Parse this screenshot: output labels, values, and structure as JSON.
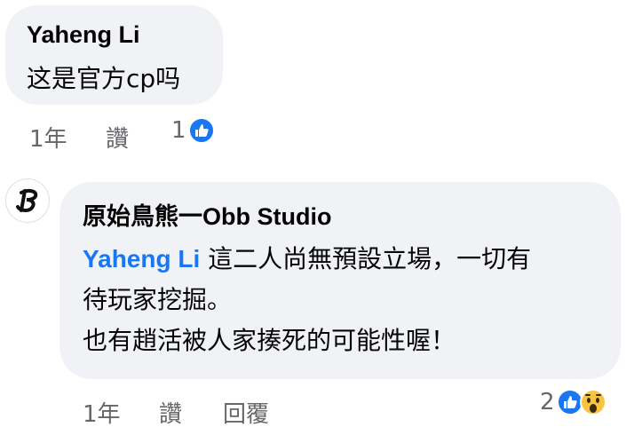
{
  "comments": [
    {
      "author": "Yaheng Li",
      "text": "这是官方cp吗",
      "time": "1年",
      "like_label": "讚",
      "reaction_count": "1",
      "reactions": [
        "like-icon"
      ]
    },
    {
      "author": "原始鳥熊一Obb Studio",
      "mention": "Yaheng Li",
      "line1": " 這二人尚無預設立場，一切有",
      "line2": "待玩家挖掘。",
      "line3": "也有趙活被人家揍死的可能性喔！",
      "time": "1年",
      "like_label": "讚",
      "reply_label": "回覆",
      "reaction_count": "2",
      "reactions": [
        "like-icon",
        "wow-icon"
      ]
    }
  ],
  "colors": {
    "bubble": "#f0f2f5",
    "meta": "#65676b",
    "mention": "#1877f2",
    "like": "#1877f2",
    "wow": "#f7c43f"
  }
}
